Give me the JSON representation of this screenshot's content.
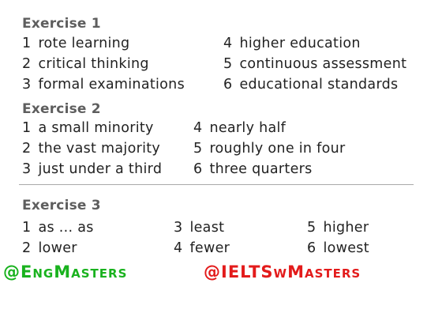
{
  "exercise1": {
    "title": "Exercise 1",
    "items": [
      {
        "num": "1",
        "text": "rote learning"
      },
      {
        "num": "2",
        "text": "critical thinking"
      },
      {
        "num": "3",
        "text": "formal examinations"
      },
      {
        "num": "4",
        "text": "higher education"
      },
      {
        "num": "5",
        "text": "continuous assessment"
      },
      {
        "num": "6",
        "text": "educational standards"
      }
    ]
  },
  "exercise2": {
    "title": "Exercise 2",
    "items": [
      {
        "num": "1",
        "text": "a small minority"
      },
      {
        "num": "2",
        "text": "the vast majority"
      },
      {
        "num": "3",
        "text": "just under a third"
      },
      {
        "num": "4",
        "text": "nearly half"
      },
      {
        "num": "5",
        "text": "roughly one in four"
      },
      {
        "num": "6",
        "text": "three quarters"
      }
    ]
  },
  "exercise3": {
    "title": "Exercise 3",
    "items": [
      {
        "num": "1",
        "text": "as ... as"
      },
      {
        "num": "2",
        "text": "lower"
      },
      {
        "num": "3",
        "text": "least"
      },
      {
        "num": "4",
        "text": "fewer"
      },
      {
        "num": "5",
        "text": "higher"
      },
      {
        "num": "6",
        "text": "lowest"
      }
    ]
  },
  "watermarks": {
    "left": {
      "at": "@",
      "initial1": "E",
      "rest1": "NG",
      "initial2": "M",
      "rest2": "ASTERS",
      "color": "#19b21e"
    },
    "right": {
      "at": "@",
      "initial1": "IELTS",
      "rest1": "W",
      "initial2": "M",
      "rest2": "ASTERS",
      "color": "#e31b1b"
    }
  }
}
